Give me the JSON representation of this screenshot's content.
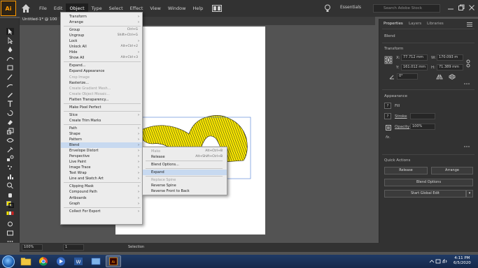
{
  "app": {
    "logo": "Ai"
  },
  "menubar": [
    "File",
    "Edit",
    "Object",
    "Type",
    "Select",
    "Effect",
    "View",
    "Window",
    "Help"
  ],
  "workspace": "Essentials",
  "search": {
    "placeholder": "Search Adobe Stock"
  },
  "doc_tab": "Untitled-1* @ 100",
  "object_menu": {
    "items": [
      {
        "label": "Transform",
        "submenu": true
      },
      {
        "label": "Arrange",
        "submenu": true
      },
      {
        "sep": true
      },
      {
        "label": "Group",
        "shortcut": "Ctrl+G"
      },
      {
        "label": "Ungroup",
        "shortcut": "Shift+Ctrl+G"
      },
      {
        "label": "Lock",
        "submenu": true
      },
      {
        "label": "Unlock All",
        "shortcut": "Alt+Ctrl+2"
      },
      {
        "label": "Hide",
        "submenu": true
      },
      {
        "label": "Show All",
        "shortcut": "Alt+Ctrl+3"
      },
      {
        "sep": true
      },
      {
        "label": "Expand..."
      },
      {
        "label": "Expand Appearance"
      },
      {
        "label": "Crop Image",
        "disabled": true
      },
      {
        "label": "Rasterize..."
      },
      {
        "label": "Create Gradient Mesh...",
        "disabled": true
      },
      {
        "label": "Create Object Mosaic...",
        "disabled": true
      },
      {
        "label": "Flatten Transparency..."
      },
      {
        "sep": true
      },
      {
        "label": "Make Pixel Perfect"
      },
      {
        "sep": true
      },
      {
        "label": "Slice",
        "submenu": true
      },
      {
        "label": "Create Trim Marks"
      },
      {
        "sep": true
      },
      {
        "label": "Path",
        "submenu": true
      },
      {
        "label": "Shape",
        "submenu": true
      },
      {
        "label": "Pattern",
        "submenu": true
      },
      {
        "label": "Blend",
        "submenu": true,
        "highlight": true
      },
      {
        "label": "Envelope Distort",
        "submenu": true
      },
      {
        "label": "Perspective",
        "submenu": true
      },
      {
        "label": "Live Paint",
        "submenu": true
      },
      {
        "label": "Image Trace",
        "submenu": true
      },
      {
        "label": "Text Wrap",
        "submenu": true
      },
      {
        "label": "Line and Sketch Art",
        "submenu": true
      },
      {
        "sep": true
      },
      {
        "label": "Clipping Mask",
        "submenu": true
      },
      {
        "label": "Compound Path",
        "submenu": true
      },
      {
        "label": "Artboards",
        "submenu": true
      },
      {
        "label": "Graph",
        "submenu": true
      },
      {
        "sep": true
      },
      {
        "label": "Collect For Export",
        "submenu": true
      }
    ]
  },
  "blend_menu": {
    "items": [
      {
        "label": "Make",
        "shortcut": "Alt+Ctrl+B",
        "disabled": true
      },
      {
        "label": "Release",
        "shortcut": "Alt+Shift+Ctrl+B"
      },
      {
        "sep": true
      },
      {
        "label": "Blend Options..."
      },
      {
        "sep": true
      },
      {
        "label": "Expand",
        "highlight": true
      },
      {
        "sep": true
      },
      {
        "label": "Replace Spine",
        "disabled": true
      },
      {
        "label": "Reverse Spine"
      },
      {
        "label": "Reverse Front to Back"
      }
    ]
  },
  "right_panel": {
    "tabs": [
      "Properties",
      "Layers",
      "Libraries"
    ],
    "object_type": "Blend",
    "transform_title": "Transform",
    "x": "77.712 mm",
    "y": "161.012 mm",
    "w": "170.093 m",
    "h": "71.389 mm",
    "rotation": "0°",
    "appearance_title": "Appearance",
    "fill": "Fill",
    "stroke": "Stroke",
    "opacity_label": "Opacity",
    "opacity_value": "100%",
    "fx": "fx.",
    "quick_actions_title": "Quick Actions",
    "btn_release": "Release",
    "btn_arrange": "Arrange",
    "btn_blend_options": "Blend Options",
    "btn_global_edit": "Start Global Edit"
  },
  "status": {
    "zoom": "100%",
    "page": "1",
    "tool": "Selection"
  },
  "taskbar": {
    "time": "4:11 PM",
    "date": "6/5/2020"
  }
}
